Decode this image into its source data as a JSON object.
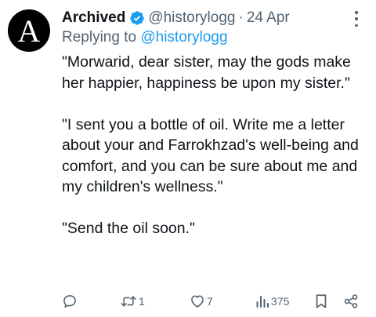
{
  "author": {
    "avatar_letter": "A",
    "name": "Archived",
    "verified_color": "#1d9bf0",
    "handle": "@historylogg",
    "separator": "·",
    "date": "24 Apr"
  },
  "reply": {
    "prefix": "Replying to",
    "mention": "@historylogg"
  },
  "body": {
    "paragraphs": [
      "\"Morwarid, dear sister, may the gods make her happier, happiness be upon my sister.\"",
      "\"I sent you a bottle of oil. Write me a letter about your and Farrokhzad's well-being and comfort, and you can be sure about me and my children's wellness.\"",
      "\"Send the oil soon.\""
    ]
  },
  "actions": {
    "reply": {
      "icon": "reply-icon",
      "count": ""
    },
    "retweet": {
      "icon": "retweet-icon",
      "count": "1"
    },
    "like": {
      "icon": "heart-icon",
      "count": "7"
    },
    "views": {
      "icon": "views-icon",
      "count": "375"
    },
    "bookmark": {
      "icon": "bookmark-icon"
    },
    "share": {
      "icon": "share-icon"
    }
  },
  "colors": {
    "text": "#0f1419",
    "secondary": "#536471",
    "link": "#1d9bf0"
  }
}
